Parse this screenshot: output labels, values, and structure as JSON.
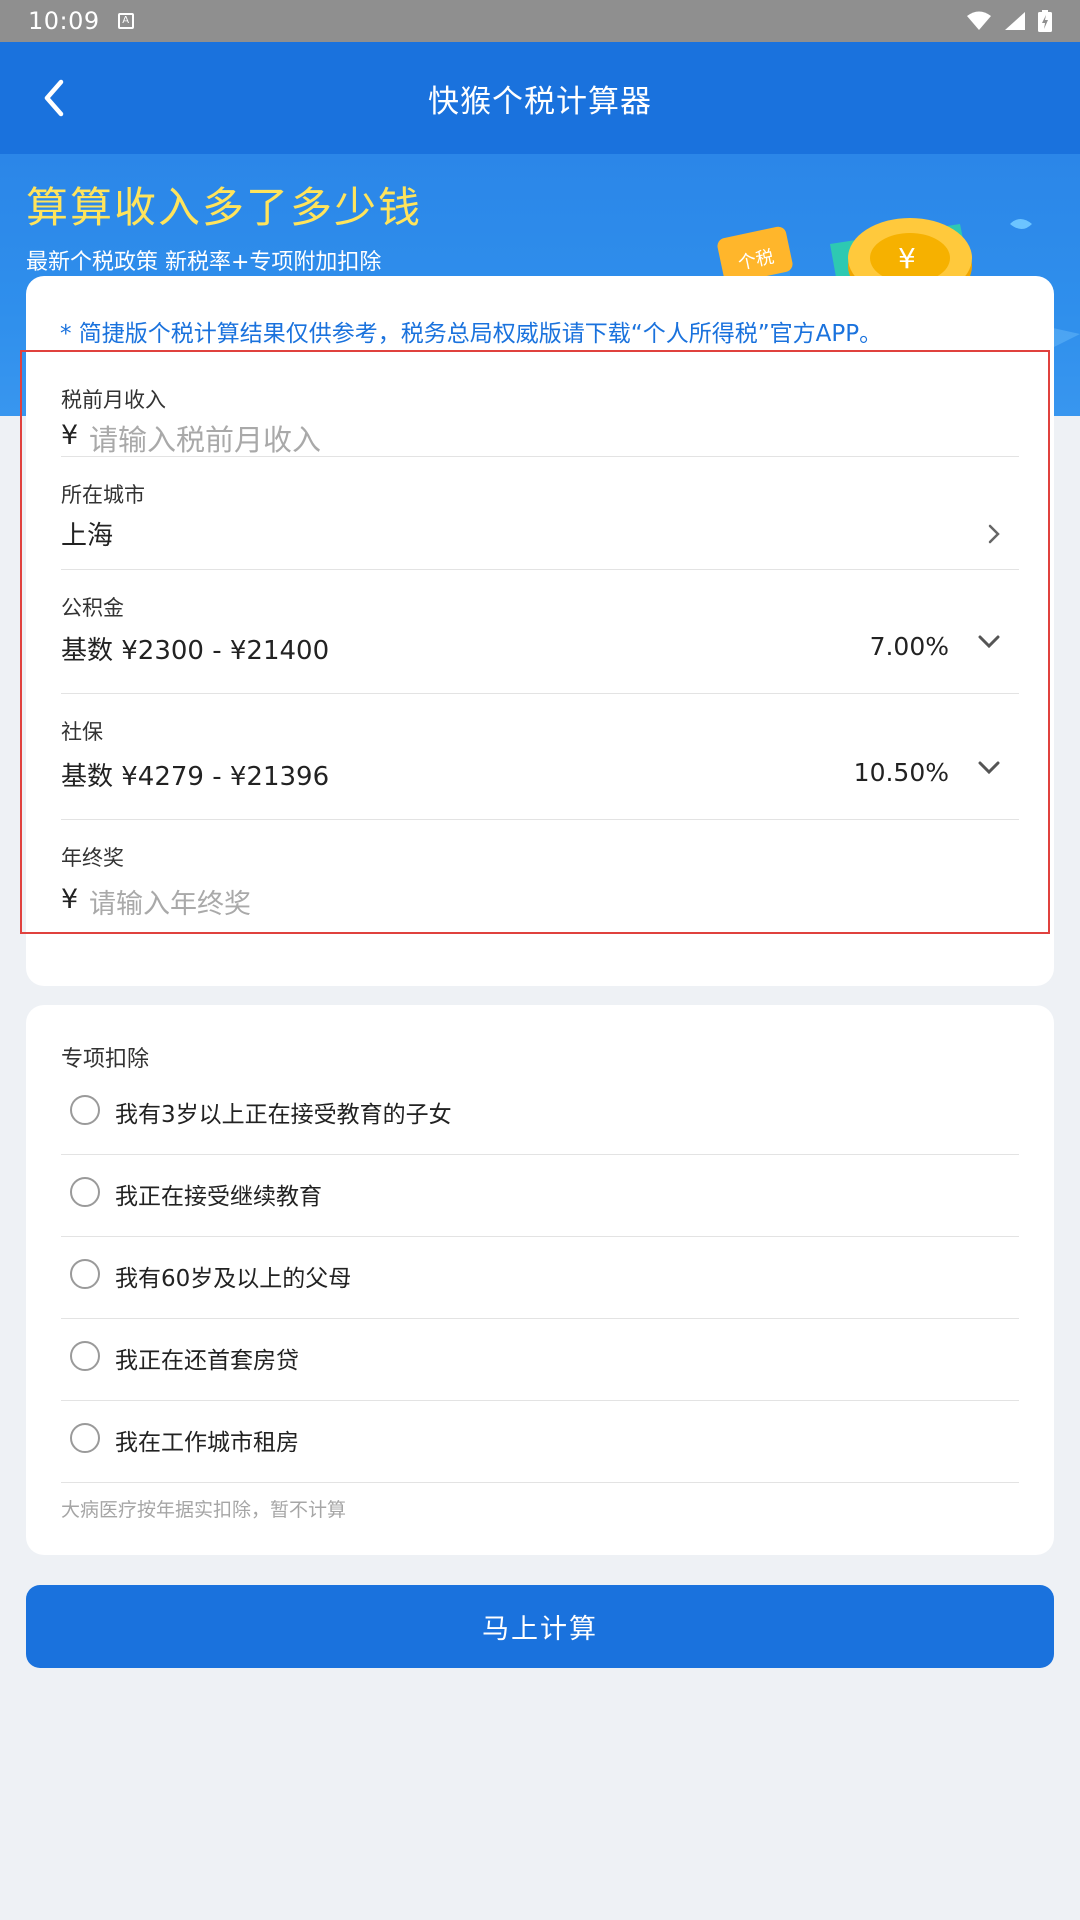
{
  "status_bar": {
    "time": "10:09",
    "notification_icon": "a-icon",
    "right_icons": [
      "wifi-icon",
      "signal-icon",
      "battery-charging-icon"
    ]
  },
  "app_bar": {
    "title": "快猴个税计算器",
    "back_icon": "chevron-left-icon"
  },
  "banner": {
    "headline": "算算收入多了多少钱",
    "subline": "最新个税政策 新税率+专项附加扣除",
    "badge_text": "个税",
    "coin_symbol": "¥"
  },
  "notice": "* 简捷版个税计算结果仅供参考，税务总局权威版请下载“个人所得税”官方APP。",
  "form": {
    "income": {
      "label": "税前月收入",
      "currency": "¥",
      "placeholder": "请输入税前月收入"
    },
    "city": {
      "label": "所在城市",
      "value": "上海"
    },
    "fund": {
      "label": "公积金",
      "value": "基数 ¥2300 - ¥21400",
      "rate": "7.00%"
    },
    "social": {
      "label": "社保",
      "value": "基数 ¥4279 - ¥21396",
      "rate": "10.50%"
    },
    "bonus": {
      "label": "年终奖",
      "currency": "¥",
      "placeholder": "请输入年终奖"
    }
  },
  "deductions": {
    "title": "专项扣除",
    "options": [
      "我有3岁以上正在接受教育的子女",
      "我正在接受继续教育",
      "我有60岁及以上的父母",
      "我正在还首套房贷",
      "我在工作城市租房"
    ],
    "note": "大病医疗按年据实扣除，暂不计算"
  },
  "calculate_button": "马上计算",
  "colors": {
    "primary": "#1a72dd",
    "headline": "#ffe45c",
    "highlight": "#e0413e",
    "background": "#eef1f5"
  }
}
